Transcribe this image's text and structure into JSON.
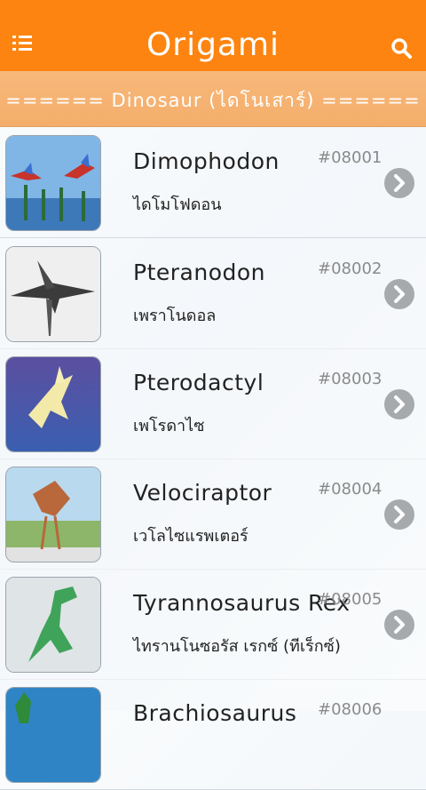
{
  "appbar": {
    "title": "Origami",
    "menu_icon": "list-menu-icon",
    "search_icon": "search-icon",
    "color": "#fd8410"
  },
  "category": {
    "label": "======  Dinosaur  (ไดโนเสาร์)  ======"
  },
  "items": [
    {
      "name_en": "Dimophodon",
      "name_th": "ไดโมโฟดอน",
      "code": "#08001"
    },
    {
      "name_en": "Pteranodon",
      "name_th": "เพราโนดอล",
      "code": "#08002"
    },
    {
      "name_en": "Pterodactyl",
      "name_th": "เพโรดาไซ",
      "code": "#08003"
    },
    {
      "name_en": "Velociraptor",
      "name_th": "เวโลไซแรพเตอร์",
      "code": "#08004"
    },
    {
      "name_en": "Tyrannosaurus  Rex",
      "name_th": "ไทรานโนซอรัส เรกซ์ (ทีเร็กซ์)",
      "code": "#08005"
    },
    {
      "name_en": "Brachiosaurus",
      "name_th": "",
      "code": "#08006"
    }
  ],
  "chevron_icon": "chevron-right-icon"
}
